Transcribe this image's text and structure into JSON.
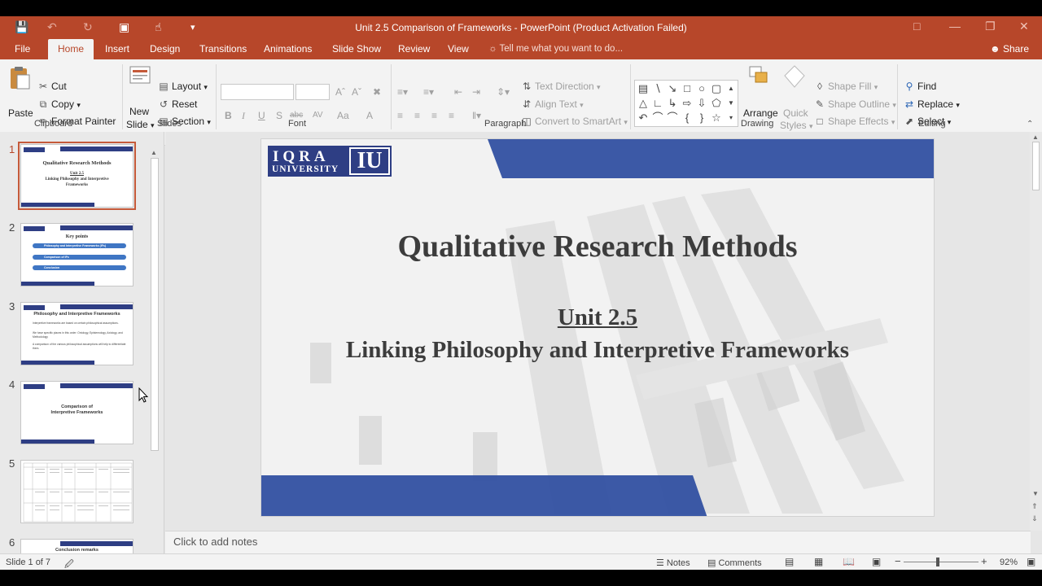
{
  "window": {
    "title": "Unit 2.5 Comparison of Frameworks - PowerPoint (Product Activation Failed)"
  },
  "tabs": [
    {
      "label": "File"
    },
    {
      "label": "Home",
      "active": true
    },
    {
      "label": "Insert"
    },
    {
      "label": "Design"
    },
    {
      "label": "Transitions"
    },
    {
      "label": "Animations"
    },
    {
      "label": "Slide Show"
    },
    {
      "label": "Review"
    },
    {
      "label": "View"
    }
  ],
  "tell_me": "Tell me what you want to do...",
  "share": "Share",
  "ribbon": {
    "clipboard": {
      "label": "Clipboard",
      "paste": "Paste",
      "cut": "Cut",
      "copy": "Copy",
      "format_painter": "Format Painter"
    },
    "slides": {
      "label": "Slides",
      "new_slide_1": "New",
      "new_slide_2": "Slide",
      "layout": "Layout",
      "reset": "Reset",
      "section": "Section"
    },
    "font": {
      "label": "Font",
      "bold": "B",
      "italic": "I",
      "underline": "U",
      "shadow": "S",
      "strike": "abc",
      "spacing": "AV",
      "case": "Aa",
      "color": "A"
    },
    "paragraph": {
      "label": "Paragraph",
      "text_direction": "Text Direction",
      "align_text": "Align Text",
      "convert_smartart": "Convert to SmartArt"
    },
    "drawing": {
      "label": "Drawing",
      "arrange": "Arrange",
      "quick_styles_1": "Quick",
      "quick_styles_2": "Styles",
      "shape_fill": "Shape Fill",
      "shape_outline": "Shape Outline",
      "shape_effects": "Shape Effects"
    },
    "editing": {
      "label": "Editing",
      "find": "Find",
      "replace": "Replace",
      "select": "Select"
    }
  },
  "thumbnails": [
    {
      "num": "1",
      "line1": "Qualitative Research Methods",
      "line2": "Unit 2.5",
      "line3": "Linking Philosophy and Interpretive",
      "line4": "Frameworks"
    },
    {
      "num": "2",
      "line1": "Key points",
      "items": [
        "Philosophy and Interpretive Frameworks (IFs)",
        "Comparison of IFs",
        "Conclusion"
      ]
    },
    {
      "num": "3",
      "line1": "Philosophy and Interpretive Frameworks",
      "bullets": [
        "Interpretive frameworks are based on certain philosophical assumptions.",
        "We have specific places in this order: Ontology, Epistemology, Axiology, and Methodology",
        "A comparison of the various philosophical assumptions will help to differentiate them."
      ]
    },
    {
      "num": "4",
      "line1": "Comparison of",
      "line2": "Interpretive Frameworks"
    },
    {
      "num": "5"
    },
    {
      "num": "6",
      "line1": "Conclusion remarks"
    }
  ],
  "slide": {
    "logo_iqra": "IQRA",
    "logo_university": "UNIVERSITY",
    "logo_iu": "IU",
    "title": "Qualitative Research Methods",
    "unit": "Unit 2.5",
    "subtitle": "Linking Philosophy and Interpretive Frameworks"
  },
  "notes_placeholder": "Click to add notes",
  "status": {
    "slide_counter": "Slide 1 of 7",
    "notes": "Notes",
    "comments": "Comments",
    "zoom": "92%"
  },
  "colors": {
    "accent": "#b7472a",
    "slide_blue": "#2e3e84"
  }
}
